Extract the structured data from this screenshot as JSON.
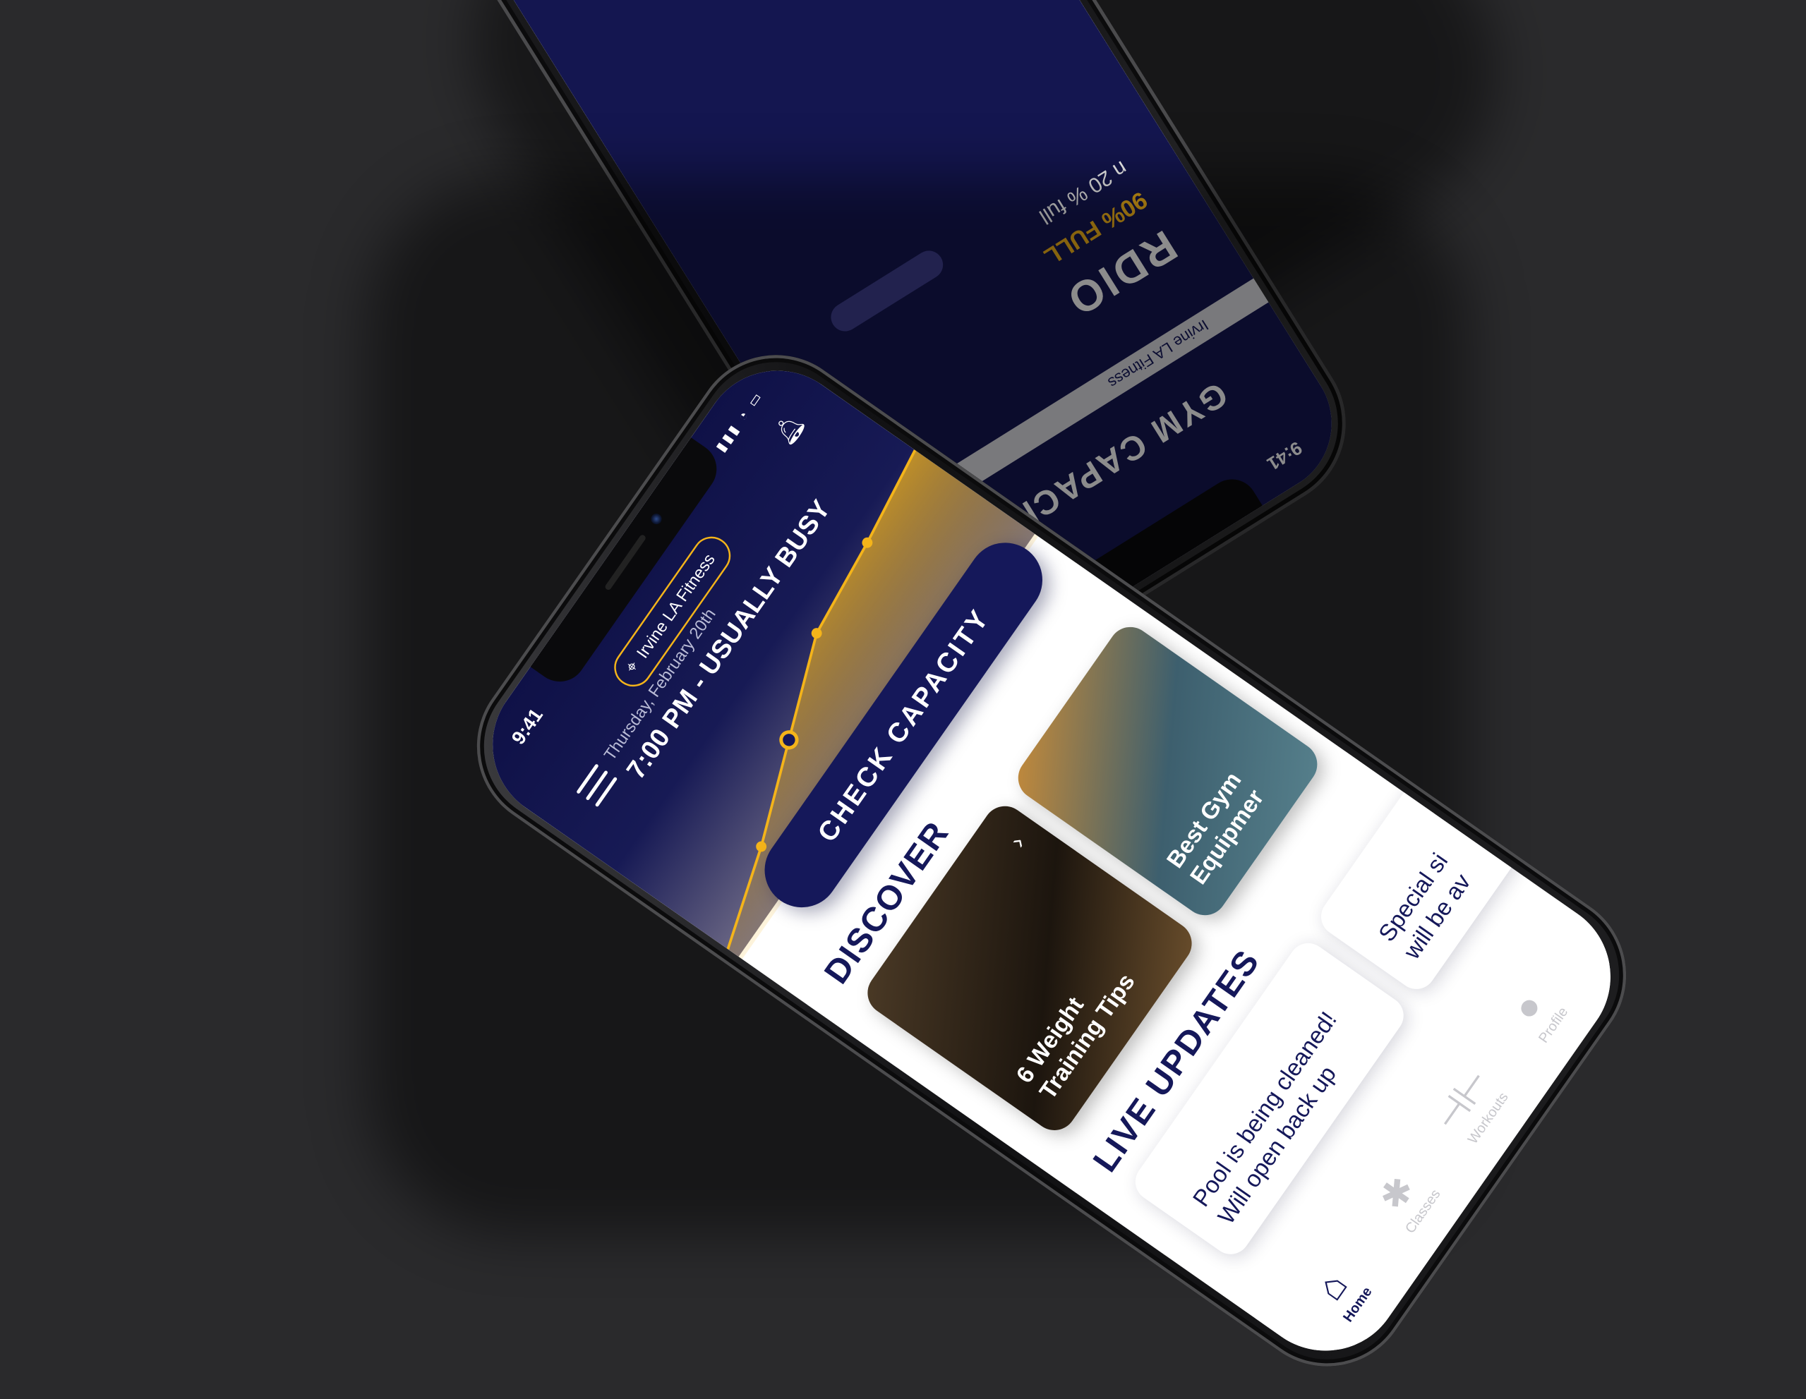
{
  "colors": {
    "navy": "#15185a",
    "gold": "#f4b41a",
    "hero_top": "#0f1147",
    "bg": "#2a2a2c"
  },
  "main_phone": {
    "status": {
      "time": "9:41",
      "icons": "wifi-icon signal-icon battery-icon"
    },
    "location": "Irvine LA Fitness",
    "date": "Thursday, February 20th",
    "headline": "7:00 PM - USUALLY BUSY",
    "check_button": "CHECK CAPACITY",
    "discover_title": "DISCOVER",
    "discover_cards": [
      {
        "label": "6 Weight\nTraining Tips"
      },
      {
        "label": "Best Gym\nEquipmer"
      }
    ],
    "live_title": "LIVE UPDATES",
    "updates": [
      {
        "text": "Pool is being cleaned!\nWill open back up"
      },
      {
        "text": "Special si\nwill be av"
      }
    ],
    "tabs": [
      {
        "label": "Home",
        "icon": "home-icon"
      },
      {
        "label": "Classes",
        "icon": "classes-icon"
      },
      {
        "label": "Workouts",
        "icon": "dumbbell-icon"
      },
      {
        "label": "Profile",
        "icon": "profile-icon"
      }
    ]
  },
  "busyness_chart": {
    "type": "line",
    "values": [
      0.1,
      0.28,
      0.5,
      0.72,
      0.78,
      0.86
    ],
    "highlight_index": 2
  },
  "secondary_phone": {
    "time": "9:41",
    "title": "GYM CAPACITY",
    "location": "Irvine LA Fitness",
    "class_name": "RDIO",
    "capacity_text": "90% FULL",
    "open_text": "n 20 % full"
  }
}
